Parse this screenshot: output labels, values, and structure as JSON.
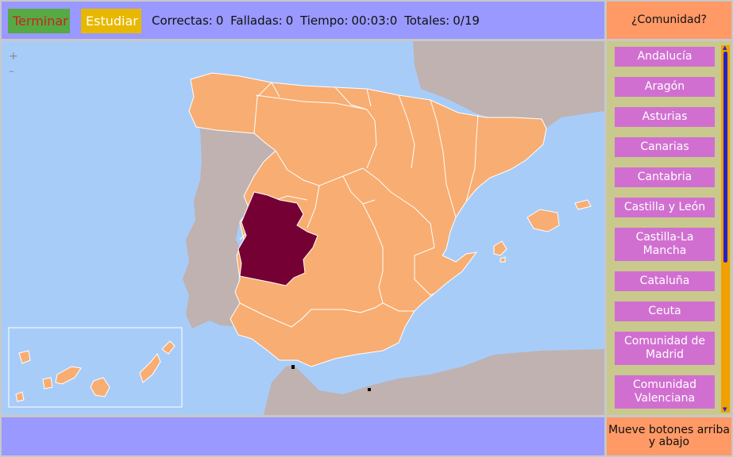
{
  "toolbar": {
    "finish_label": "Terminar",
    "study_label": "Estudiar"
  },
  "stats": {
    "correct_label": "Correctas:",
    "correct_value": "0",
    "failed_label": "Falladas:",
    "failed_value": "0",
    "time_label": "Tiempo:",
    "time_value": "00:03:0",
    "total_label": "Totales:",
    "total_value": "0/19"
  },
  "question": "¿Comunidad?",
  "map": {
    "zoom_in": "+",
    "zoom_out": "–",
    "highlighted_region": "Extremadura",
    "colors": {
      "sea": "#a8ccf8",
      "region": "#f8ad72",
      "highlight": "#750033",
      "foreign": "#bfb2b0",
      "border": "#ffffff"
    }
  },
  "communities": [
    "Andalucía",
    "Aragón",
    "Asturias",
    "Canarias",
    "Cantabria",
    "Castilla y León",
    "Castilla-La Mancha",
    "Cataluña",
    "Ceuta",
    "Comunidad de Madrid",
    "Comunidad Valenciana"
  ],
  "help_text": "Mueve botones arriba y abajo",
  "colors": {
    "bar": "#9999ff",
    "accent": "#ff9966",
    "list_item": "#d16fd1",
    "sidebar": "#c9c98e",
    "scroll_track": "#f0a000",
    "scroll_thumb": "#2222cc"
  }
}
